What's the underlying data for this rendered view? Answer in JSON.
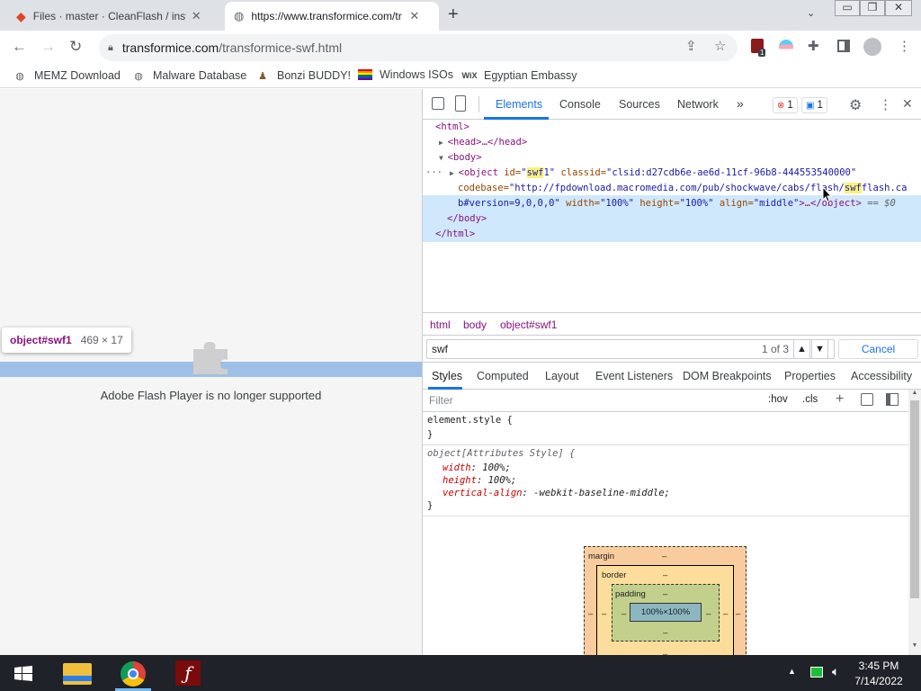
{
  "tabs": [
    {
      "title": "Files · master · CleanFlash / instal",
      "active": false
    },
    {
      "title": "https://www.transformice.com/tr",
      "active": true
    }
  ],
  "toolbar": {
    "url_host": "transformice.com",
    "url_path": "/transformice-swf.html",
    "ext_badge": "1"
  },
  "bookmarks": [
    {
      "label": "MEMZ Download",
      "icon": "globe-icon"
    },
    {
      "label": "Malware Database",
      "icon": "globe-icon"
    },
    {
      "label": "Bonzi BUDDY!",
      "icon": "bonzi-icon"
    },
    {
      "label": "Windows ISOs",
      "icon": "rainbow-flag-icon"
    },
    {
      "label": "Egyptian Embassy",
      "icon": "wix-icon"
    }
  ],
  "page": {
    "tooltip_selector": "object#swf1",
    "tooltip_size": "469 × 17",
    "message": "Adobe Flash Player is no longer supported"
  },
  "devtools": {
    "tabs": [
      "Elements",
      "Console",
      "Sources",
      "Network"
    ],
    "more": "»",
    "error_count": "1",
    "message_count": "1",
    "tree": {
      "html_open": "<html>",
      "head": "<head>…</head>",
      "body_open": "<body>",
      "obj_tag": "<object ",
      "id_attr": "id=",
      "id_val_a": "\"",
      "id_val_hl": "swf",
      "id_val_b": "1\"",
      "classid_attr": " classid=",
      "classid_val": "\"clsid:d27cdb6e-ae6d-11cf-96b8-444553540000\"",
      "codebase_attr": "codebase=",
      "codebase_val_a": "\"http://fpdownload.macromedia.com/pub/shockwave/cabs/flash/",
      "codebase_hl": "swf",
      "codebase_val_b": "flash.ca",
      "line3_a": "b#version=9,0,0,0\"",
      "width_attr": " width=",
      "width_val": "\"100%\"",
      "height_attr": " height=",
      "height_val": "\"100%\"",
      "align_attr": " align=",
      "align_val": "\"middle\"",
      "close_obj": ">…</object>",
      "eq": " == $0",
      "body_close": "</body>",
      "html_close": "</html>"
    },
    "breadcrumb": [
      "html",
      "body",
      "object#swf1"
    ],
    "search": {
      "value": "swf",
      "count": "1 of 3",
      "cancel": "Cancel"
    },
    "style_tabs": [
      "Styles",
      "Computed",
      "Layout",
      "Event Listeners",
      "DOM Breakpoints",
      "Properties",
      "Accessibility"
    ],
    "filter": {
      "placeholder": "Filter",
      "hov": ":hov",
      "cls": ".cls"
    },
    "rules": {
      "r1_selector": "element.style {",
      "r1_close": "}",
      "r2_selector": "object[Attributes Style] {",
      "p1_name": "width",
      "p1_val": " 100%;",
      "p2_name": "height",
      "p2_val": " 100%;",
      "p3_name": "vertical-align",
      "p3_val": " -webkit-baseline-middle;",
      "r2_close": "}"
    },
    "boxmodel": {
      "margin": "margin",
      "border": "border",
      "padding": "padding",
      "content": "100%×100%",
      "dash": "–"
    }
  },
  "taskbar": {
    "time": "3:45 PM",
    "date": "7/14/2022"
  }
}
